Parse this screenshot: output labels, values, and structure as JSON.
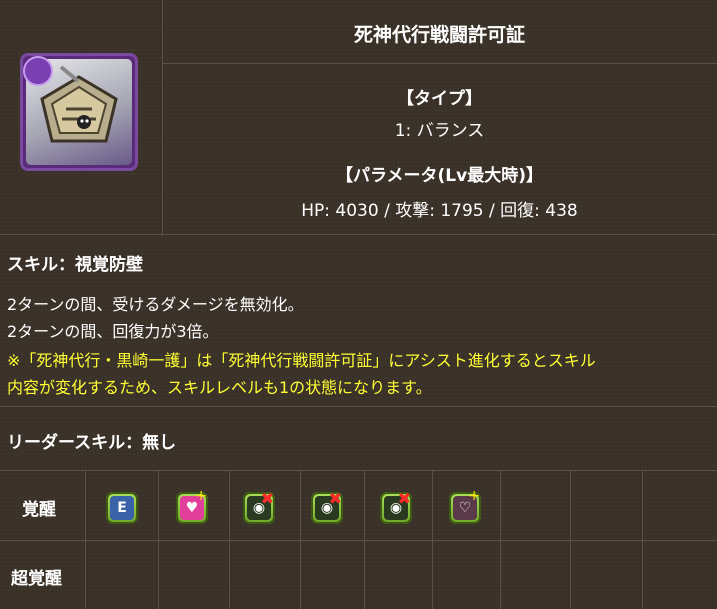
{
  "card": {
    "name": "死神代行戦闘許可証",
    "type_heading": "【タイプ】",
    "type_value": "1: バランス",
    "param_heading": "【パラメータ(Lv最大時)】",
    "param_value": "HP: 4030 / 攻撃: 1795 / 回復: 438",
    "colors": {
      "attribute": "#7a3fb0"
    }
  },
  "skill": {
    "title": "スキル：視覚防壁",
    "lines": [
      "2ターンの間、受けるダメージを無効化。",
      "2ターンの間、回復力が3倍。"
    ],
    "note": [
      "※「死神代行・黒崎一護」は「死神代行戦闘許可証」にアシスト進化するとスキル",
      "内容が変化するため、スキルレベルも1の状態になります。"
    ]
  },
  "leader": {
    "title": "リーダースキル：無し"
  },
  "awakening": {
    "label": "覚醒",
    "icons": [
      {
        "name": "skill-boost-icon",
        "glyph": "E"
      },
      {
        "name": "heart-plus-icon",
        "glyph": "♥"
      },
      {
        "name": "blind-resist-icon",
        "glyph": "◉"
      },
      {
        "name": "blind-resist-icon",
        "glyph": "◉"
      },
      {
        "name": "blind-resist-icon",
        "glyph": "◉"
      },
      {
        "name": "heal-plus-icon",
        "glyph": "♡"
      }
    ]
  },
  "super_awakening": {
    "label": "超覚醒"
  }
}
